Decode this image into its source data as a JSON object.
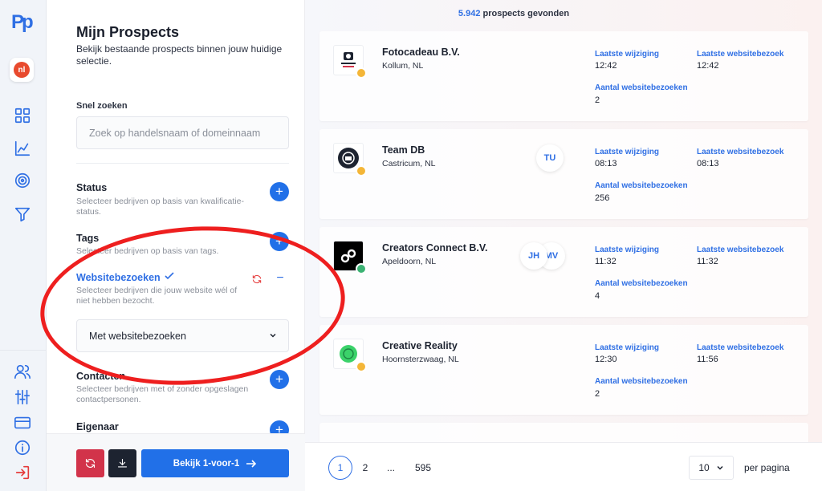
{
  "rail": {
    "logo": "Pp",
    "language": "nl"
  },
  "panel": {
    "title": "Mijn Prospects",
    "subtitle": "Bekijk bestaande prospects binnen jouw huidige selectie.",
    "quick_search_label": "Snel zoeken",
    "search_placeholder": "Zoek op handelsnaam of domeinnaam",
    "filters": [
      {
        "title": "Status",
        "desc": "Selecteer bedrijven op basis van kwalificatie-status."
      },
      {
        "title": "Tags",
        "desc": "Selecteer bedrijven op basis van tags."
      },
      {
        "title": "Websitebezoeken",
        "desc": "Selecteer bedrijven die jouw website wél of niet hebben bezocht.",
        "selected": "Met websitebezoeken"
      },
      {
        "title": "Contacten",
        "desc": "Selecteer bedrijven met of zonder opgeslagen contactpersonen."
      },
      {
        "title": "Eigenaar",
        "desc": ""
      }
    ],
    "primary_button": "Bekijk 1-voor-1"
  },
  "main": {
    "count": "5.942",
    "count_suffix": "prospects gevonden",
    "labels": {
      "changed": "Laatste wijziging",
      "last_visit": "Laatste websitebezoek",
      "visits": "Aantal websitebezoeken"
    },
    "prospects": [
      {
        "name": "Fotocadeau B.V.",
        "location": "Kollum, NL",
        "changed": "12:42",
        "last_visit": "12:42",
        "visits": "2",
        "avatars": [],
        "dot": "#f4b638"
      },
      {
        "name": "Team DB",
        "location": "Castricum, NL",
        "changed": "08:13",
        "last_visit": "08:13",
        "visits": "256",
        "avatars": [
          "TU"
        ],
        "dot": "#f4b638"
      },
      {
        "name": "Creators Connect B.V.",
        "location": "Apeldoorn, NL",
        "changed": "11:32",
        "last_visit": "11:32",
        "visits": "4",
        "avatars": [
          "JH",
          "MV"
        ],
        "dot": "#3bb273"
      },
      {
        "name": "Creative Reality",
        "location": "Hoornsterzwaag, NL",
        "changed": "12:30",
        "last_visit": "11:56",
        "visits": "2",
        "avatars": [],
        "dot": "#f4b638"
      }
    ]
  },
  "pagination": {
    "pages": [
      "1",
      "2",
      "...",
      "595"
    ],
    "per_page": "10",
    "per_page_label": "per pagina"
  },
  "colors": {
    "accent": "#2170e8",
    "danger": "#d2334a",
    "annotation": "#ee1f1f"
  }
}
